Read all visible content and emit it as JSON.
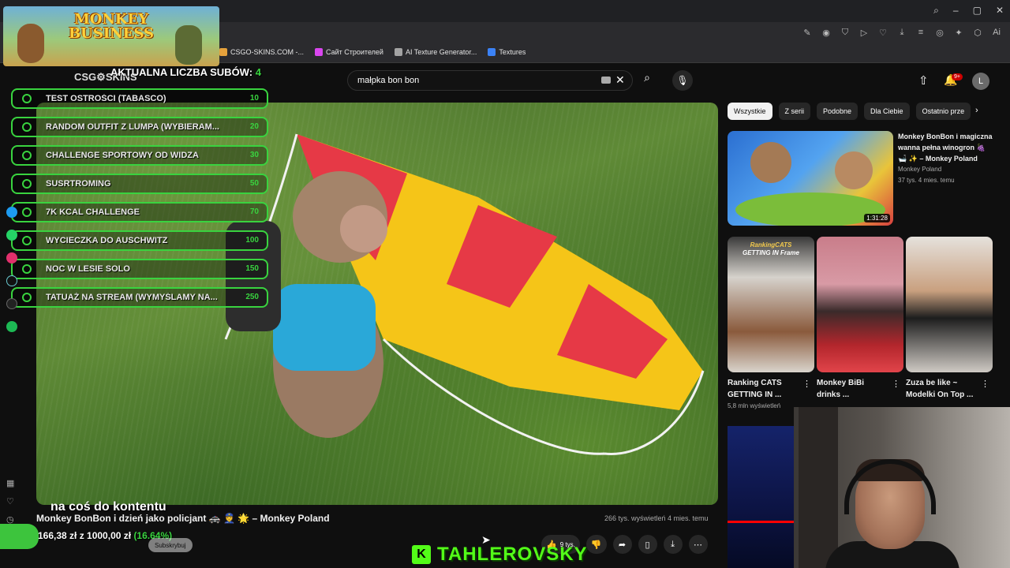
{
  "browser": {
    "bookmarks": [
      {
        "label": "CSGO-SKINS.COM -...",
        "color": "#e6a23c"
      },
      {
        "label": "Сайт Строителей",
        "color": "#d946ef"
      },
      {
        "label": "AI Texture Generator...",
        "color": "#a3a3a3"
      },
      {
        "label": "Textures",
        "color": "#3b82f6"
      }
    ]
  },
  "header": {
    "search_value": "małpka bon bon",
    "clear_icon": "✕",
    "search_icon": "⌕",
    "mic_icon": "🎙",
    "upload_icon": "⇧",
    "bell_icon": "🔔",
    "notif_badge": "9+",
    "avatar_letter": "L"
  },
  "overlay": {
    "ad_title_line1": "MONKEY",
    "ad_title_line2": "BUSINESS",
    "logo": "CSG⚙SKINS",
    "sub_counter_label": "AKTUALNA LICZBA SUBÓW:",
    "sub_counter_value": "4",
    "goals": [
      {
        "label": "TEST OSTROŚCI (TABASCO)",
        "points": "10"
      },
      {
        "label": "RANDOM OUTFIT Z LUMPA (WYBIERAM...",
        "points": "20"
      },
      {
        "label": "CHALLENGE SPORTOWY OD WIDZA",
        "points": "30"
      },
      {
        "label": "SUSRTROMING",
        "points": "50"
      },
      {
        "label": "7K KCAL CHALLENGE",
        "points": "70"
      },
      {
        "label": "WYCIECZKA DO AUSCHWITZ",
        "points": "100"
      },
      {
        "label": "NOC W LESIE SOLO",
        "points": "150"
      },
      {
        "label": "TATUAŻ NA STREAM (WYMYŚLAMY NA...",
        "points": "250"
      }
    ],
    "caption": "na coś do kontentu",
    "donation_text": "166,38 zł z 1000,00 zł",
    "donation_pct": "(16.64%)",
    "donation_progress": 0.1664,
    "subscribe_label": "Subskrybuj",
    "brand_letter": "K",
    "brand_name": "TAHLEROVSKY",
    "accent": "#39d33f"
  },
  "video": {
    "title": "Monkey BonBon i dzień jako policjant 🚓 👮 🌟 – Monkey Poland",
    "meta": "266 tys. wyświetleń  4 mies. temu",
    "like_count": "9 tys."
  },
  "chips": [
    "Wszystkie",
    "Z serii",
    "Podobne",
    "Dla Ciebie",
    "Ostatnio prze"
  ],
  "recs": {
    "first": {
      "title": "Monkey BonBon i magiczna wanna pełna winogron 🍇 🛁 ✨ – Monkey Poland",
      "channel": "Monkey Poland",
      "stats": "37 tys.  4 mies. temu",
      "duration": "1:31:28"
    },
    "shorts": [
      {
        "title": "Ranking CATS GETTING IN ...",
        "sub": "5,8 mln wyświetleń",
        "cap1": "RankingCATS",
        "cap2": "GETTING IN Frame"
      },
      {
        "title": "Monkey BiBi drinks ...",
        "sub": ""
      },
      {
        "title": "Zuza be like ~ Modelki On Top ...",
        "sub": ""
      }
    ]
  }
}
